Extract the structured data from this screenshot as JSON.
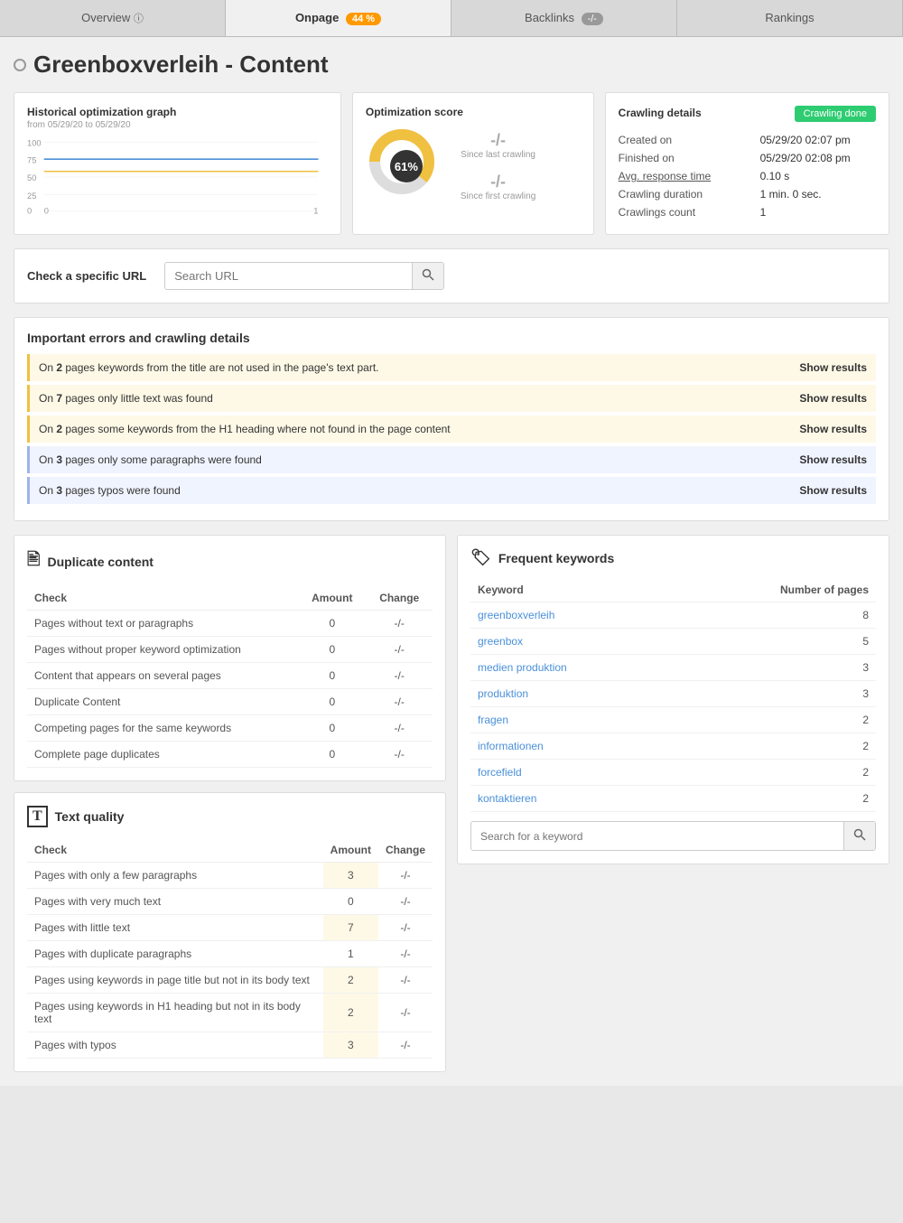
{
  "tabs": [
    {
      "id": "overview",
      "label": "Overview",
      "badge": null,
      "badgeColor": null,
      "active": false
    },
    {
      "id": "onpage",
      "label": "Onpage",
      "badge": "44 %",
      "badgeColor": "orange",
      "active": true
    },
    {
      "id": "backlinks",
      "label": "Backlinks",
      "badge": "-/-",
      "badgeColor": "gray",
      "active": false
    },
    {
      "id": "rankings",
      "label": "Rankings",
      "badge": null,
      "badgeColor": null,
      "active": false
    }
  ],
  "pageTitle": "Greenboxverleih - Content",
  "historicalGraph": {
    "title": "Historical optimization graph",
    "subtitle": "from 05/29/20 to 05/29/20",
    "yLabels": [
      "100",
      "75",
      "50",
      "25",
      "0"
    ],
    "xLabels": [
      "0",
      "1"
    ]
  },
  "optimizationScore": {
    "title": "Optimization score",
    "percent": "61%",
    "sinceLastCrawling": "-/-",
    "sinceFirstCrawling": "-/-",
    "labelLast": "Since last crawling",
    "labelFirst": "Since first crawling"
  },
  "crawlingDetails": {
    "title": "Crawling details",
    "badge": "Crawling done",
    "rows": [
      {
        "label": "Created on",
        "value": "05/29/20 02:07 pm"
      },
      {
        "label": "Finished on",
        "value": "05/29/20 02:08 pm"
      },
      {
        "label": "Avg. response time",
        "value": "0.10 s",
        "underline": true
      },
      {
        "label": "Crawling duration",
        "value": "1 min. 0 sec."
      },
      {
        "label": "Crawlings count",
        "value": "1"
      }
    ]
  },
  "urlCheck": {
    "label": "Check a specific URL",
    "placeholder": "Search URL"
  },
  "errorsSection": {
    "title": "Important errors and crawling details",
    "errors": [
      {
        "type": "yellow",
        "text": "On 2 pages keywords from the title are not used in the page's text part.",
        "showResults": "Show results",
        "bold": "2"
      },
      {
        "type": "yellow",
        "text": "On 7 pages only little text was found",
        "showResults": "Show results",
        "bold": "7"
      },
      {
        "type": "yellow",
        "text": "On 2 pages some keywords from the H1 heading where not found in the page content",
        "showResults": "Show results",
        "bold": "2"
      },
      {
        "type": "blue",
        "text": "On 3 pages only some paragraphs were found",
        "showResults": "Show results",
        "bold": "3"
      },
      {
        "type": "blue",
        "text": "On 3 pages typos were found",
        "showResults": "Show results",
        "bold": "3"
      }
    ]
  },
  "duplicateContent": {
    "title": "Duplicate content",
    "headers": [
      "Check",
      "Amount",
      "Change"
    ],
    "rows": [
      {
        "check": "Pages without text or paragraphs",
        "amount": "0",
        "change": "-/-",
        "highlight": false
      },
      {
        "check": "Pages without proper keyword optimization",
        "amount": "0",
        "change": "-/-",
        "highlight": false
      },
      {
        "check": "Content that appears on several pages",
        "amount": "0",
        "change": "-/-",
        "highlight": false
      },
      {
        "check": "Duplicate Content",
        "amount": "0",
        "change": "-/-",
        "highlight": false
      },
      {
        "check": "Competing pages for the same keywords",
        "amount": "0",
        "change": "-/-",
        "highlight": false
      },
      {
        "check": "Complete page duplicates",
        "amount": "0",
        "change": "-/-",
        "highlight": false
      }
    ]
  },
  "textQuality": {
    "title": "Text quality",
    "headers": [
      "Check",
      "Amount",
      "Change"
    ],
    "rows": [
      {
        "check": "Pages with only a few paragraphs",
        "amount": "3",
        "change": "-/-",
        "highlight": true
      },
      {
        "check": "Pages with very much text",
        "amount": "0",
        "change": "-/-",
        "highlight": false
      },
      {
        "check": "Pages with little text",
        "amount": "7",
        "change": "-/-",
        "highlight": true
      },
      {
        "check": "Pages with duplicate paragraphs",
        "amount": "1",
        "change": "-/-",
        "highlight": false
      },
      {
        "check": "Pages using keywords in page title but not in its body text",
        "amount": "2",
        "change": "-/-",
        "highlight": true
      },
      {
        "check": "Pages using keywords in H1 heading but not in its body text",
        "amount": "2",
        "change": "-/-",
        "highlight": true
      },
      {
        "check": "Pages with typos",
        "amount": "3",
        "change": "-/-",
        "highlight": true
      }
    ]
  },
  "frequentKeywords": {
    "title": "Frequent keywords",
    "headers": [
      "Keyword",
      "Number of pages"
    ],
    "rows": [
      {
        "keyword": "greenboxverleih",
        "count": "8"
      },
      {
        "keyword": "greenbox",
        "count": "5"
      },
      {
        "keyword": "medien produktion",
        "count": "3"
      },
      {
        "keyword": "produktion",
        "count": "3"
      },
      {
        "keyword": "fragen",
        "count": "2"
      },
      {
        "keyword": "informationen",
        "count": "2"
      },
      {
        "keyword": "forcefield",
        "count": "2"
      },
      {
        "keyword": "kontaktieren",
        "count": "2"
      }
    ],
    "searchPlaceholder": "Search for a keyword"
  }
}
